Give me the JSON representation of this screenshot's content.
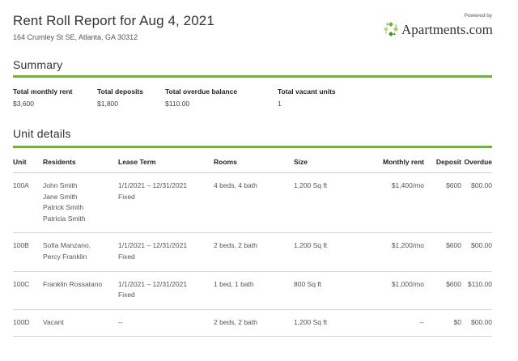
{
  "report": {
    "title": "Rent Roll Report for Aug 4, 2021",
    "address": "164 Crumley St SE, Atlanta, GA 30312"
  },
  "brand": {
    "powered_by": "Powered by",
    "name": "Apartments.com"
  },
  "summary": {
    "title": "Summary",
    "items": [
      {
        "label": "Total monthly rent",
        "value": "$3,600"
      },
      {
        "label": "Total deposits",
        "value": "$1,800"
      },
      {
        "label": "Total overdue balance",
        "value": "$110.00"
      },
      {
        "label": "Total vacant units",
        "value": "1"
      }
    ]
  },
  "units": {
    "title": "Unit details",
    "headers": [
      "Unit",
      "Residents",
      "Lease Term",
      "Rooms",
      "Size",
      "Monthly rent",
      "Deposit",
      "Overdue"
    ],
    "rows": [
      {
        "unit": "100A",
        "residents": [
          "John Smith",
          "Jane Smith",
          "Patrick Smith",
          "Patricia Smith"
        ],
        "lease": [
          "1/1/2021 – 12/31/2021",
          "Fixed"
        ],
        "rooms": "4 beds, 4 bath",
        "size": "1,200 Sq ft",
        "rent": "$1,400/mo",
        "deposit": "$600",
        "overdue": "$00.00"
      },
      {
        "unit": "100B",
        "residents": [
          "Sofia Manzano,",
          "Percy Franklin"
        ],
        "lease": [
          "1/1/2021 – 12/31/2021",
          "Fixed"
        ],
        "rooms": "2 beds, 2 bath",
        "size": "1,200 Sq ft",
        "rent": "$1,200/mo",
        "deposit": "$600",
        "overdue": "$00.00"
      },
      {
        "unit": "100C",
        "residents": [
          "Franklin Rossatano"
        ],
        "lease": [
          "1/1/2021 – 12/31/2021",
          "Fixed"
        ],
        "rooms": "1 bed, 1 bath",
        "size": "800 Sq ft",
        "rent": "$1,000/mo",
        "deposit": "$600",
        "overdue": "$110.00"
      },
      {
        "unit": "100D",
        "residents": [
          "Vacant"
        ],
        "lease": [
          "--"
        ],
        "rooms": "2 beds, 2 bath",
        "size": "1,200 Sq ft",
        "rent": "--",
        "deposit": "$0",
        "overdue": "$00.00"
      }
    ]
  },
  "colors": {
    "accent": "#6ab72d",
    "logo_petals": [
      "#6ab72d",
      "#9ccf4f",
      "#4a8f22",
      "#b7dc78"
    ]
  },
  "icons": {
    "brand_logo": "apartments-logo-icon"
  }
}
